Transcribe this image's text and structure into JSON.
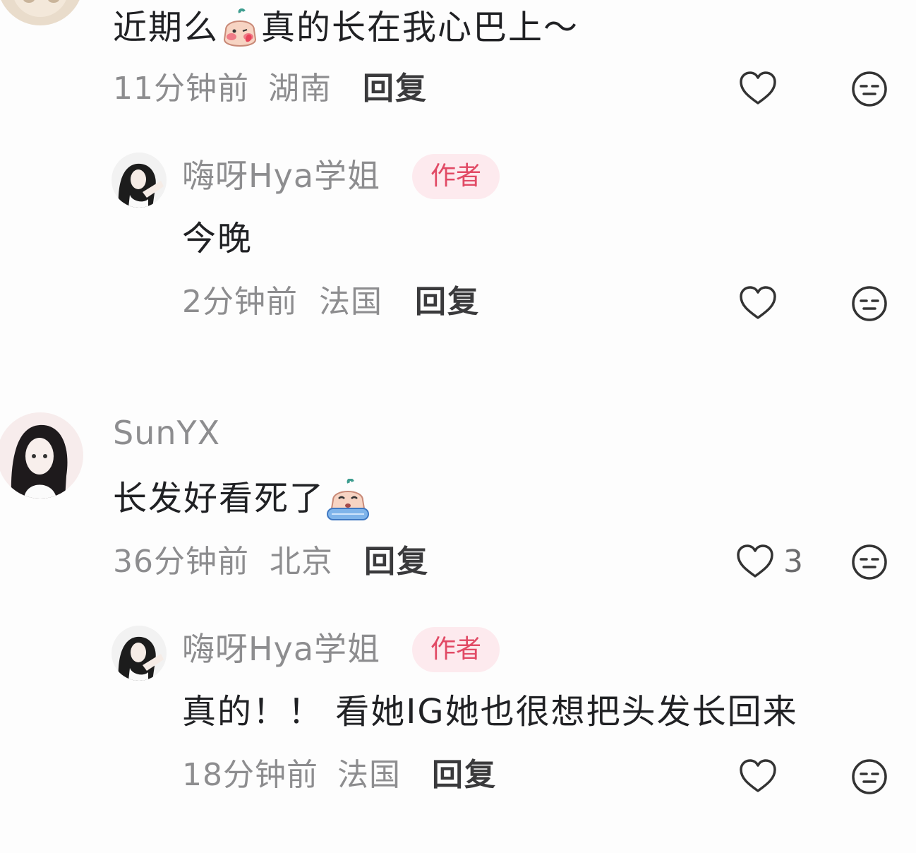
{
  "comments": [
    {
      "content_before": "近期么",
      "content_after": "真的长在我心巴上～",
      "time": "11分钟前",
      "location": "湖南",
      "reply_label": "回复",
      "replies": [
        {
          "username": "嗨呀Hya学姐",
          "badge": "作者",
          "content": "今晚",
          "time": "2分钟前",
          "location": "法国",
          "reply_label": "回复"
        }
      ]
    },
    {
      "username": "SunYX",
      "content": "长发好看死了",
      "time": "36分钟前",
      "location": "北京",
      "reply_label": "回复",
      "like_count": "3",
      "replies": [
        {
          "username": "嗨呀Hya学姐",
          "badge": "作者",
          "content": "真的！！ 看她IG她也很想把头发长回来",
          "time": "18分钟前",
          "location": "法国",
          "reply_label": "回复"
        }
      ]
    }
  ],
  "colors": {
    "badge_bg": "#fdeaee",
    "badge_text": "#e14a65",
    "meta": "#8d8d8f"
  },
  "icons": [
    "heart-icon",
    "dislike-face-icon",
    "blush-emoji",
    "crying-emoji"
  ]
}
